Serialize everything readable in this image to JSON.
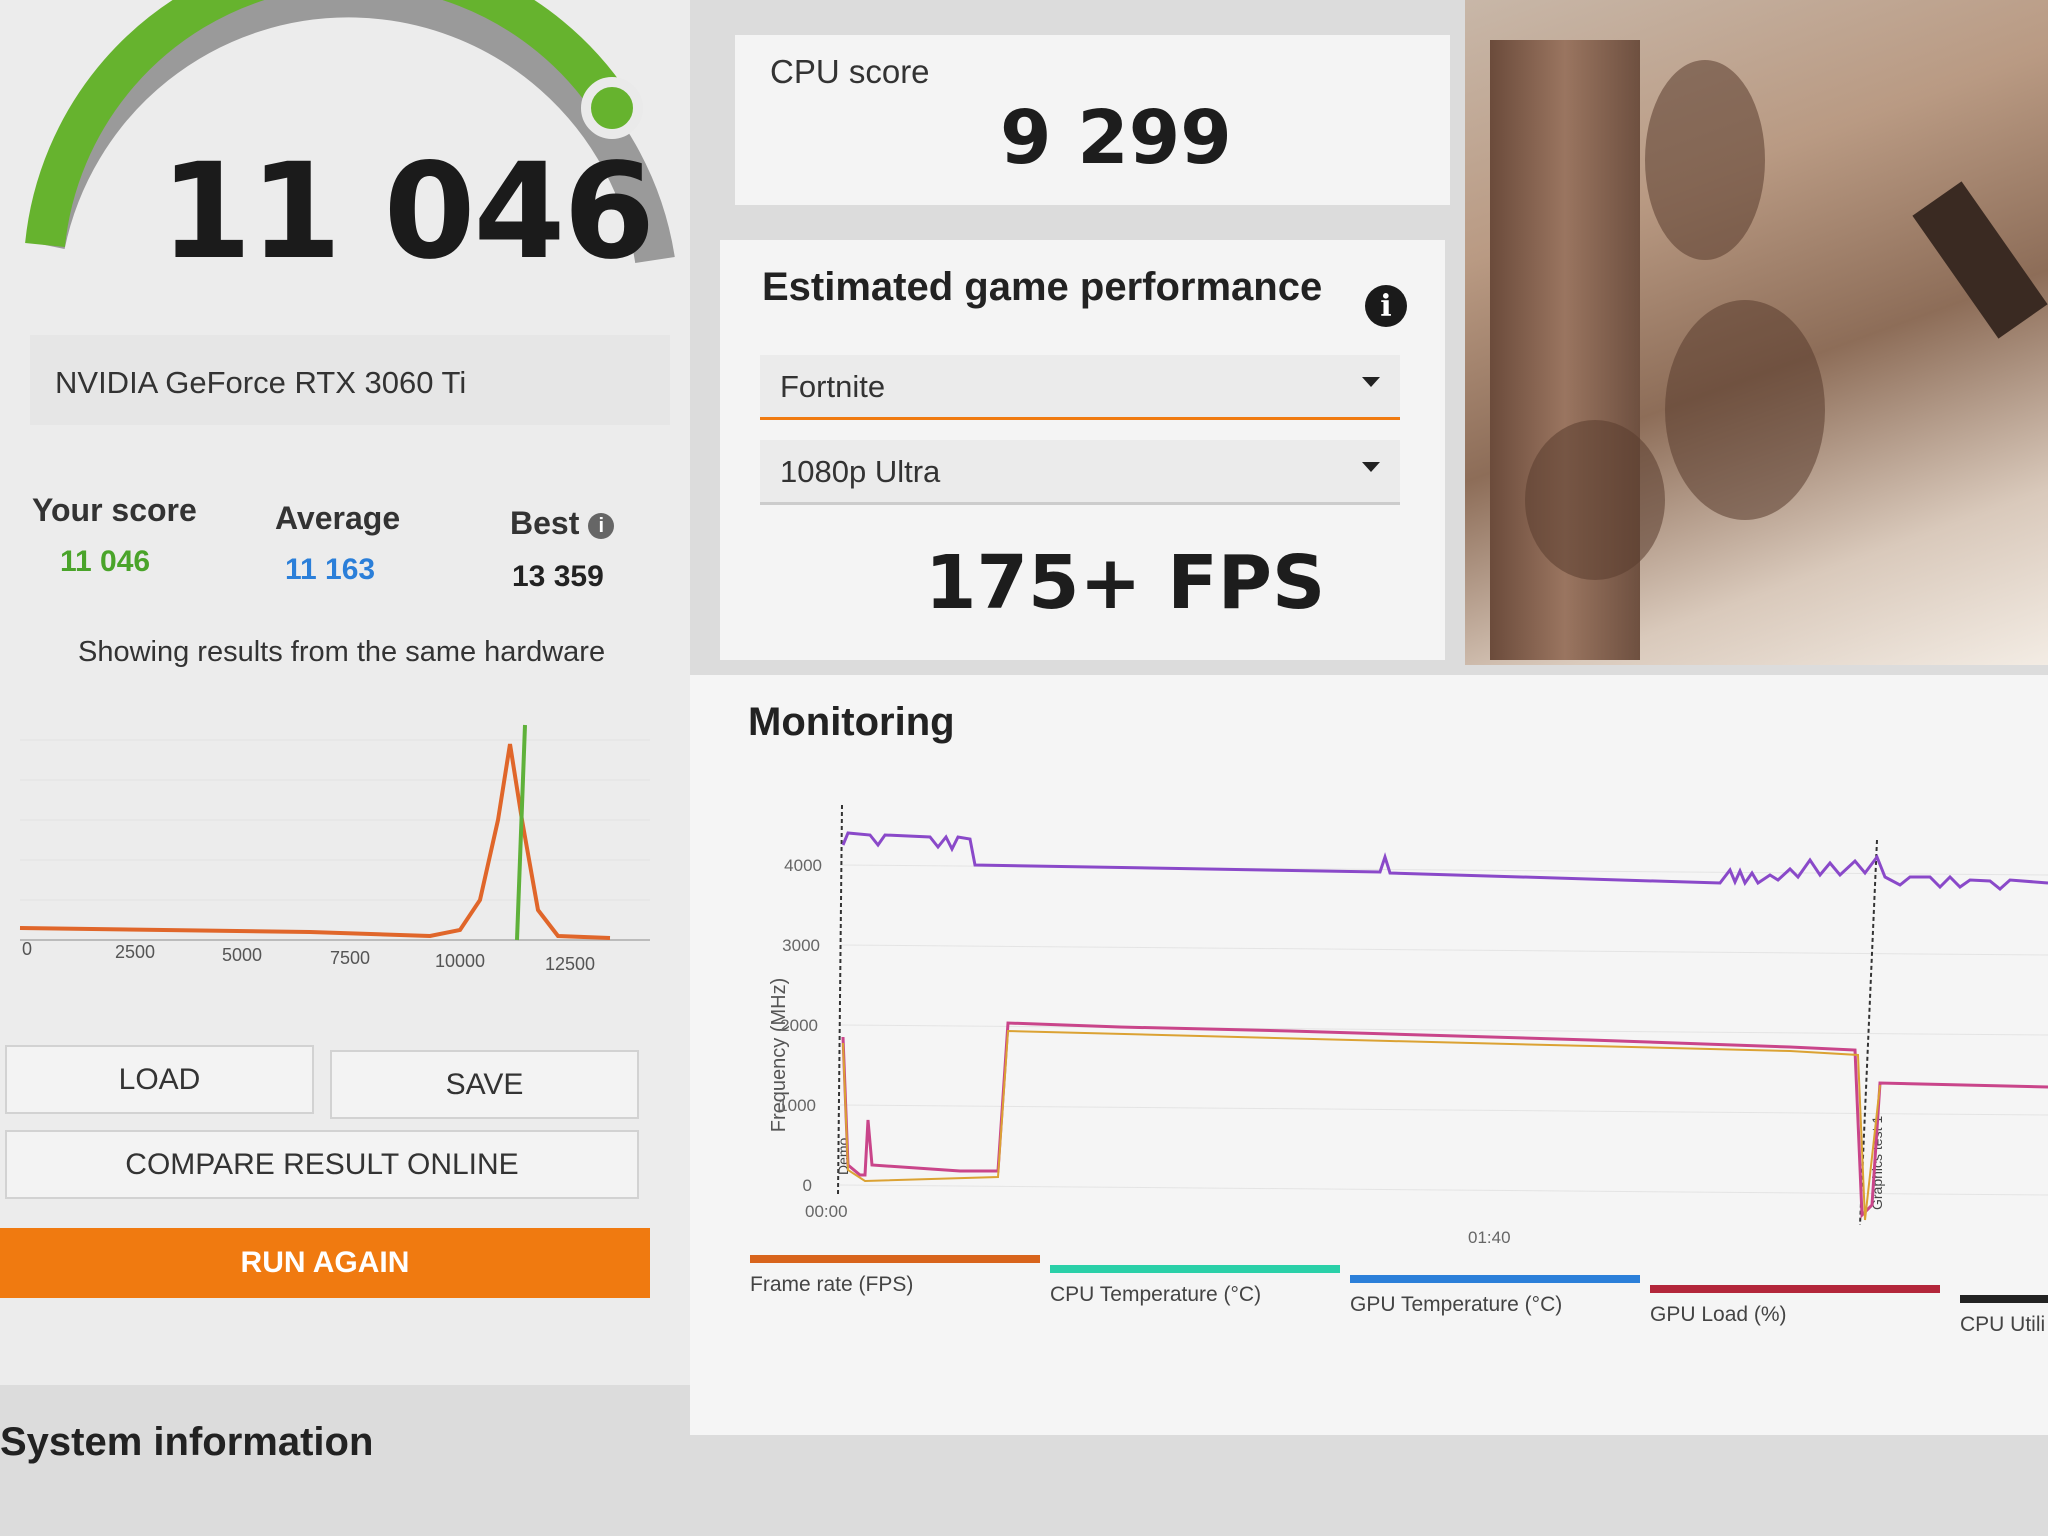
{
  "score": {
    "main_value": "11 046",
    "gpu_name": "NVIDIA GeForce RTX 3060 Ti",
    "gauge_fraction": 0.82,
    "accent_color": "#66b32e"
  },
  "comparison": {
    "your_score_label": "Your score",
    "your_score_value": "11 046",
    "average_label": "Average",
    "average_value": "11 163",
    "best_label": "Best",
    "best_value": "13 359",
    "showing_text": "Showing results from the same hardware"
  },
  "histogram": {
    "ticks": [
      "0",
      "2500",
      "5000",
      "7500",
      "10000",
      "12500"
    ],
    "distribution_color": "#e0662a",
    "marker_color": "#5fb13a"
  },
  "buttons": {
    "load": "LOAD",
    "save": "SAVE",
    "compare": "COMPARE RESULT ONLINE",
    "run_again": "RUN AGAIN"
  },
  "cpu": {
    "label": "CPU score",
    "value": "9 299"
  },
  "estimated": {
    "title": "Estimated game performance",
    "game": "Fortnite",
    "preset": "1080p Ultra",
    "fps": "175+ FPS"
  },
  "monitoring": {
    "title": "Monitoring",
    "y_label": "Frequency (MHz)",
    "y_ticks": [
      "4000",
      "3000",
      "2000",
      "1000",
      "0"
    ],
    "x_ticks": [
      "00:00",
      "01:40"
    ],
    "marker_labels": [
      "Demo",
      "Graphics test 1"
    ],
    "legend": [
      {
        "label": "Frame rate (FPS)",
        "color": "#d8641c"
      },
      {
        "label": "CPU Temperature (°C)",
        "color": "#2ad0a8"
      },
      {
        "label": "GPU Temperature (°C)",
        "color": "#2b7fd9"
      },
      {
        "label": "GPU Load (%)",
        "color": "#b3263a"
      },
      {
        "label": "CPU Utili",
        "color": "#222222"
      }
    ]
  },
  "system_info": {
    "title": "System information"
  }
}
